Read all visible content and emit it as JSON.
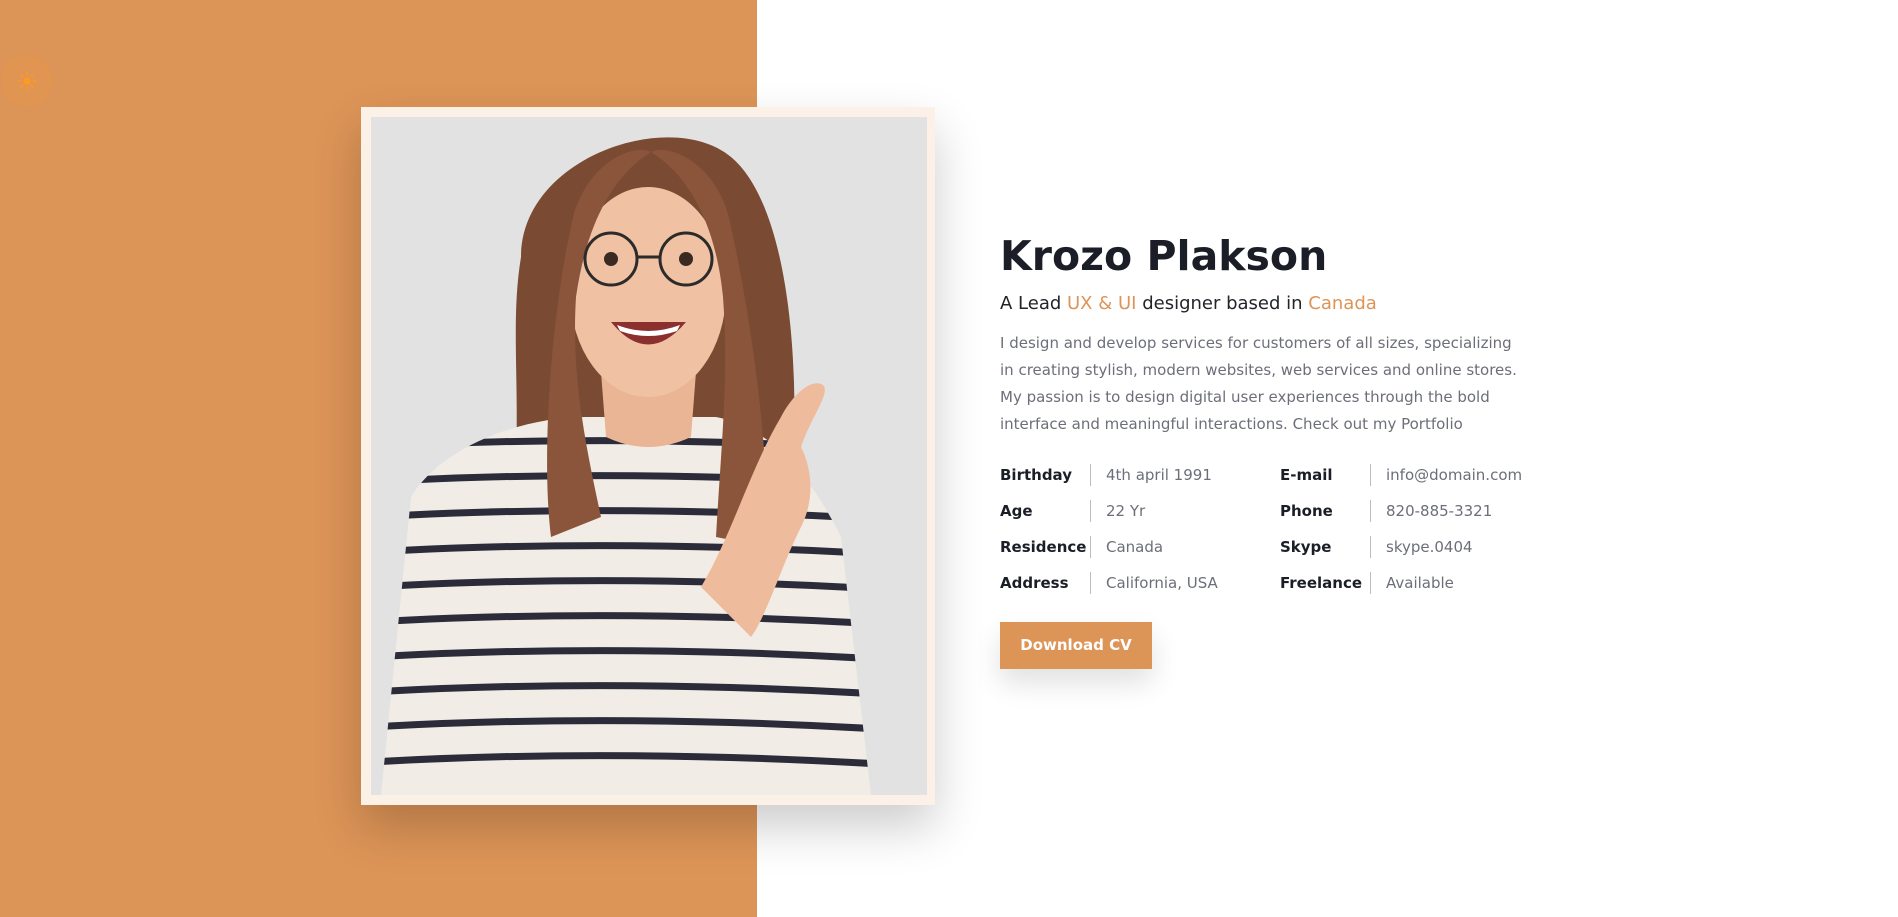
{
  "profile": {
    "name": "Krozo Plakson",
    "tagline": {
      "prefix": "A Lead ",
      "skill": "UX & UI",
      "middle": " designer based in ",
      "location": "Canada"
    },
    "bio": "I design and develop services for customers of all sizes, specializing in creating stylish, modern websites, web services and online stores. My passion is to design digital user experiences through the bold interface and meaningful interactions. Check out my Portfolio"
  },
  "info": [
    {
      "label": "Birthday",
      "value": "4th april 1991"
    },
    {
      "label": "E-mail",
      "value": "info@domain.com"
    },
    {
      "label": "Age",
      "value": "22 Yr"
    },
    {
      "label": "Phone",
      "value": "820-885-3321"
    },
    {
      "label": "Residence",
      "value": "Canada"
    },
    {
      "label": "Skype",
      "value": "skype.0404"
    },
    {
      "label": "Address",
      "value": "California, USA"
    },
    {
      "label": "Freelance",
      "value": "Available"
    }
  ],
  "cta": {
    "download_label": "Download CV"
  },
  "icons": {
    "theme_toggle": "sun-icon"
  },
  "colors": {
    "accent": "#dd9457",
    "frame": "#fcf1e6",
    "photo_background": "#e2e2e2",
    "heading": "#1b1e27",
    "muted_text": "#6c6f79"
  }
}
